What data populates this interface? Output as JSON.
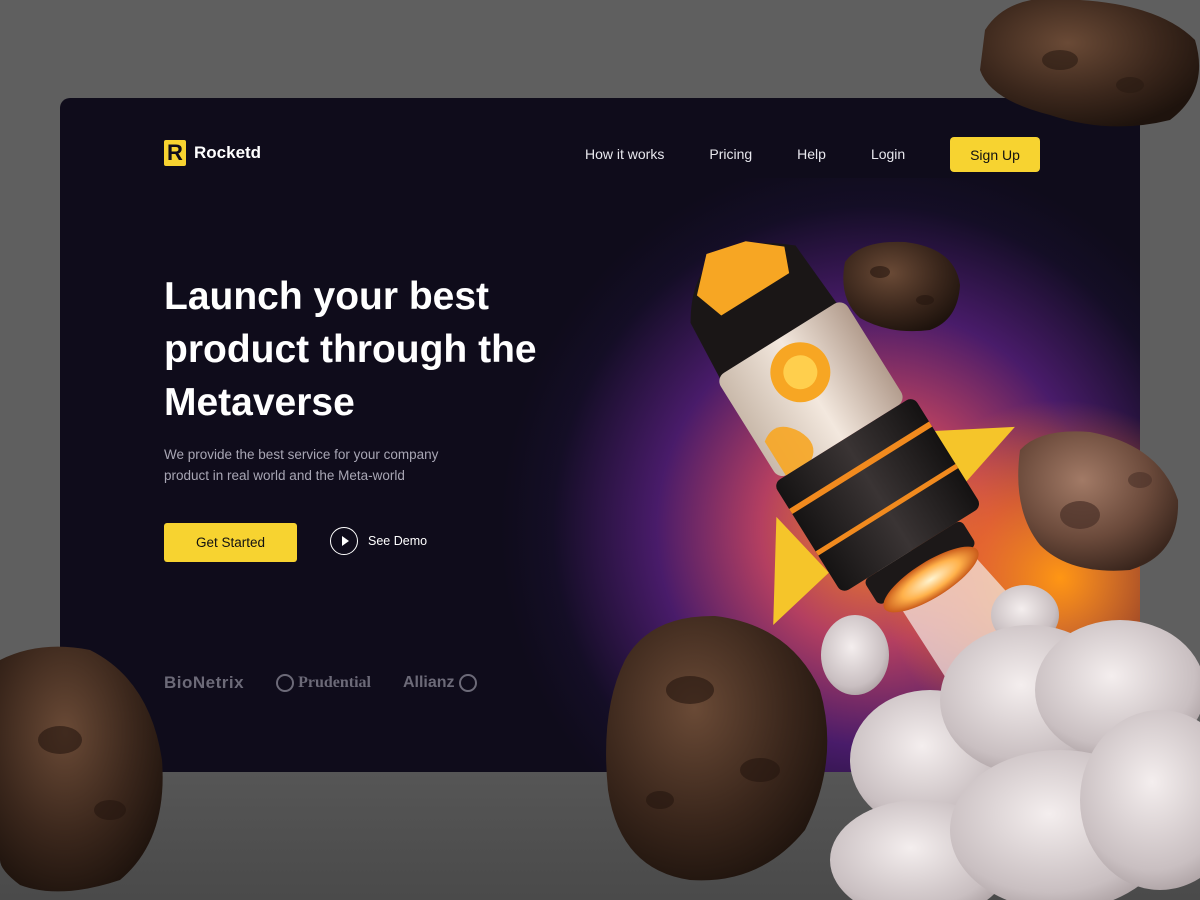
{
  "brand": {
    "name": "Rocketd",
    "mark": "R"
  },
  "nav": [
    {
      "label": "How it works"
    },
    {
      "label": "Pricing"
    },
    {
      "label": "Help"
    },
    {
      "label": "Login"
    }
  ],
  "signup_label": "Sign Up",
  "hero": {
    "headline": "Launch your best product through the Metaverse",
    "subtext": "We provide the best service for your company product in real world and the Meta-world",
    "cta_primary": "Get Started",
    "cta_secondary": "See Demo"
  },
  "partners": [
    {
      "name": "BioNetrix"
    },
    {
      "name": "Prudential"
    },
    {
      "name": "Allianz"
    }
  ],
  "colors": {
    "accent": "#f7d330",
    "card_bg": "#0f0c1b",
    "page_bg": "#5f5f5f"
  },
  "icons": {
    "play": "play-icon",
    "logo": "logo-icon"
  }
}
